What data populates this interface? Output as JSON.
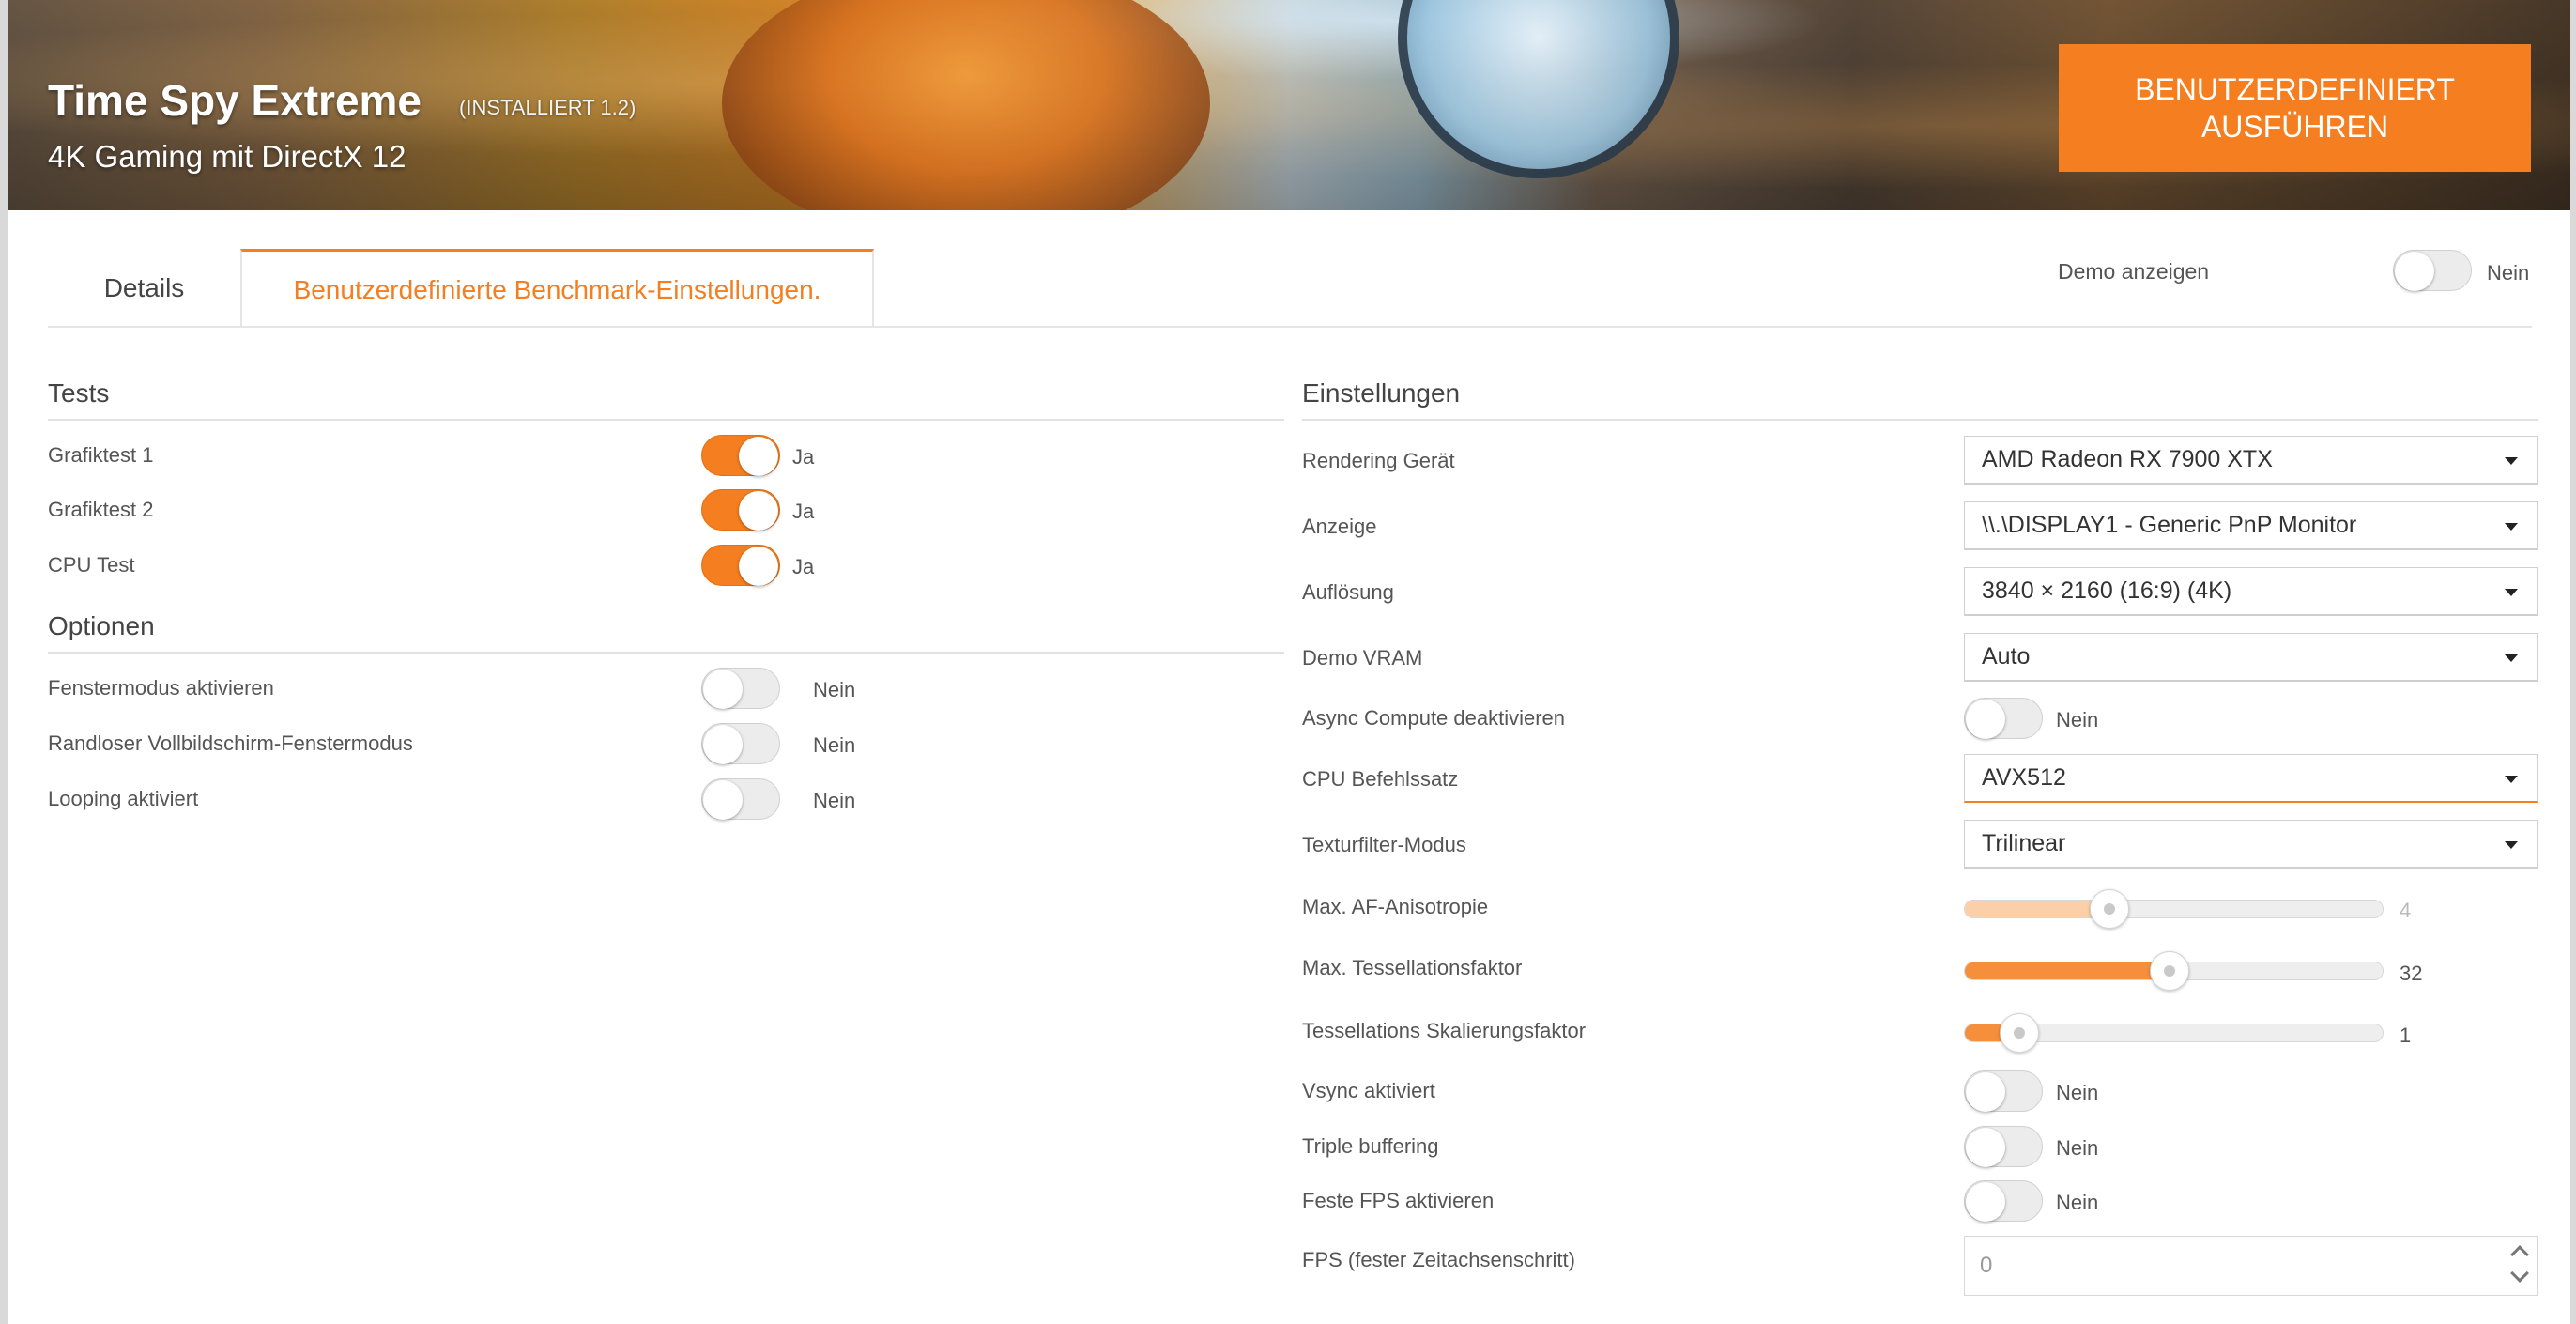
{
  "banner": {
    "title": "Time Spy Extreme",
    "version": "(INSTALLIERT 1.2)",
    "subtitle": "4K Gaming mit DirectX 12",
    "run_button": "BENUTZERDEFINIERT AUSFÜHREN"
  },
  "tabs": [
    {
      "label": "Details"
    },
    {
      "label": "Benutzerdefinierte Benchmark-Einstellungen."
    }
  ],
  "demo": {
    "label": "Demo anzeigen",
    "value": "Nein"
  },
  "tests": {
    "title": "Tests",
    "items": [
      {
        "label": "Grafiktest 1",
        "value": "Ja"
      },
      {
        "label": "Grafiktest 2",
        "value": "Ja"
      },
      {
        "label": "CPU Test",
        "value": "Ja"
      }
    ]
  },
  "options": {
    "title": "Optionen",
    "items": [
      {
        "label": "Fenstermodus aktivieren",
        "value": "Nein"
      },
      {
        "label": "Randloser Vollbildschirm-Fenstermodus",
        "value": "Nein"
      },
      {
        "label": "Looping aktiviert",
        "value": "Nein"
      }
    ]
  },
  "settings": {
    "title": "Einstellungen",
    "rendering_device": {
      "label": "Rendering Gerät",
      "value": "AMD Radeon RX 7900 XTX"
    },
    "display": {
      "label": "Anzeige",
      "value": "\\\\.\\DISPLAY1 - Generic PnP Monitor"
    },
    "resolution": {
      "label": "Auflösung",
      "value": "3840 × 2160 (16:9) (4K)"
    },
    "demo_vram": {
      "label": "Demo VRAM",
      "value": "Auto"
    },
    "async_compute": {
      "label": "Async Compute deaktivieren",
      "value": "Nein"
    },
    "cpu_instruction_set": {
      "label": "CPU Befehlssatz",
      "value": "AVX512"
    },
    "texture_filter": {
      "label": "Texturfilter-Modus",
      "value": "Trilinear"
    },
    "max_af": {
      "label": "Max. AF-Anisotropie",
      "value": "4",
      "fraction": 0.346
    },
    "max_tessellation": {
      "label": "Max. Tessellationsfaktor",
      "value": "32",
      "fraction": 0.49
    },
    "tessellation_scaling": {
      "label": "Tessellations Skalierungsfaktor",
      "value": "1",
      "fraction": 0.13
    },
    "vsync": {
      "label": "Vsync aktiviert",
      "value": "Nein"
    },
    "triple_buffering": {
      "label": "Triple buffering",
      "value": "Nein"
    },
    "fixed_fps": {
      "label": "Feste FPS aktivieren",
      "value": "Nein"
    },
    "fps_timestep": {
      "label": "FPS (fester Zeitachsenschritt)",
      "value": "0"
    }
  },
  "colors": {
    "accent": "#f47e20"
  }
}
